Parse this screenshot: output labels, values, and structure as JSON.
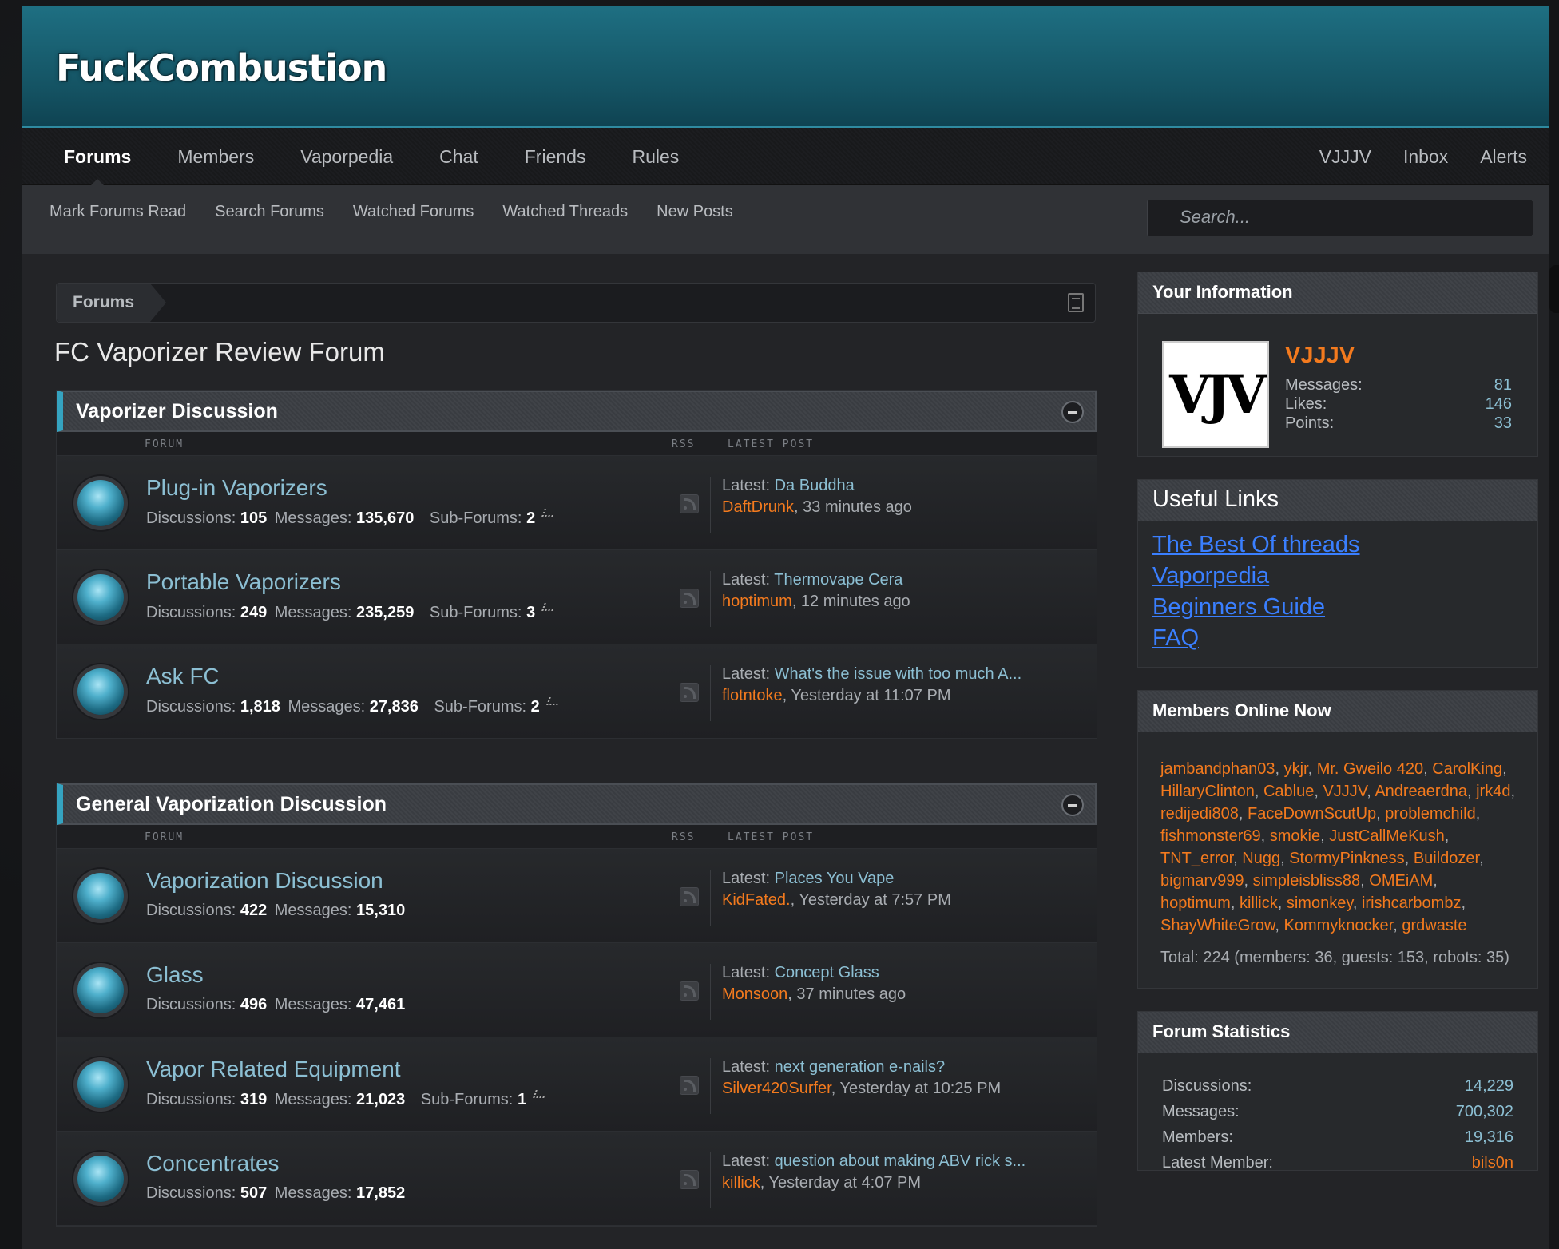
{
  "header": {
    "logo": "FuckCombustion"
  },
  "nav": {
    "left": [
      "Forums",
      "Members",
      "Vaporpedia",
      "Chat",
      "Friends",
      "Rules"
    ],
    "right": [
      "VJJJV",
      "Inbox",
      "Alerts"
    ]
  },
  "subnav": {
    "links": [
      "Mark Forums Read",
      "Search Forums",
      "Watched Forums",
      "Watched Threads",
      "New Posts"
    ],
    "search_placeholder": "Search..."
  },
  "breadcrumb": {
    "crumb": "Forums"
  },
  "page_title": "FC Vaporizer Review Forum",
  "columns": {
    "forum": "FORUM",
    "rss": "RSS",
    "latest": "LATEST POST"
  },
  "labels": {
    "discussions": "Discussions:",
    "messages": "Messages:",
    "subforums": "Sub-Forums:",
    "latest": "Latest:"
  },
  "categories": [
    {
      "title": "Vaporizer Discussion",
      "forums": [
        {
          "title": "Plug-in Vaporizers",
          "discussions": "105",
          "messages": "135,670",
          "subforums": "2",
          "thread": "Da Buddha",
          "user": "DaftDrunk",
          "time": ", 33 minutes ago"
        },
        {
          "title": "Portable Vaporizers",
          "discussions": "249",
          "messages": "235,259",
          "subforums": "3",
          "thread": "Thermovape Cera",
          "user": "hoptimum",
          "time": ", 12 minutes ago"
        },
        {
          "title": "Ask FC",
          "discussions": "1,818",
          "messages": "27,836",
          "subforums": "2",
          "thread": "What's the issue with too much A...",
          "user": "flotntoke",
          "time": ", Yesterday at 11:07 PM"
        }
      ]
    },
    {
      "title": "General Vaporization Discussion",
      "forums": [
        {
          "title": "Vaporization Discussion",
          "discussions": "422",
          "messages": "15,310",
          "subforums": "",
          "thread": "Places You Vape",
          "user": "KidFated.",
          "time": ", Yesterday at 7:57 PM"
        },
        {
          "title": "Glass",
          "discussions": "496",
          "messages": "47,461",
          "subforums": "",
          "thread": "Concept Glass",
          "user": "Monsoon",
          "time": ", 37 minutes ago"
        },
        {
          "title": "Vapor Related Equipment",
          "discussions": "319",
          "messages": "21,023",
          "subforums": "1",
          "thread": "next generation e-nails?",
          "user": "Silver420Surfer",
          "time": ", Yesterday at 10:25 PM"
        },
        {
          "title": "Concentrates",
          "discussions": "507",
          "messages": "17,852",
          "subforums": "",
          "thread": "question about making ABV rick s...",
          "user": "killick",
          "time": ", Yesterday at 4:07 PM"
        }
      ]
    }
  ],
  "sidebar": {
    "your_info": {
      "title": "Your Information",
      "avatar_text": "VJV",
      "username": "VJJJV",
      "rows": [
        {
          "label": "Messages:",
          "value": "81"
        },
        {
          "label": "Likes:",
          "value": "146"
        },
        {
          "label": "Points:",
          "value": "33"
        }
      ]
    },
    "useful_links": {
      "title": "Useful Links",
      "links": [
        "The Best Of threads",
        "Vaporpedia",
        "Beginners Guide",
        "FAQ"
      ]
    },
    "members_online": {
      "title": "Members Online Now",
      "members": [
        "jambandphan03",
        "ykjr",
        "Mr. Gweilo 420",
        "CarolKing",
        "HillaryClinton",
        "Cablue",
        "VJJJV",
        "Andreaerdna",
        "jrk4d",
        "redijedi808",
        "FaceDownScutUp",
        "problemchild",
        "fishmonster69",
        "smokie",
        "JustCallMeKush",
        "TNT_error",
        "Nugg",
        "StormyPinkness",
        "Buildozer",
        "bigmarv999",
        "simpleisbliss88",
        "OMEiAM",
        "hoptimum",
        "killick",
        "simonkey",
        "irishcarbombz",
        "ShayWhiteGrow",
        "Kommyknocker",
        "grdwaste"
      ],
      "total": "Total: 224 (members: 36, guests: 153, robots: 35)"
    },
    "forum_stats": {
      "title": "Forum Statistics",
      "rows": [
        {
          "label": "Discussions:",
          "value": "14,229"
        },
        {
          "label": "Messages:",
          "value": "700,302"
        },
        {
          "label": "Members:",
          "value": "19,316"
        },
        {
          "label": "Latest Member:",
          "value": "bils0n"
        }
      ]
    }
  }
}
